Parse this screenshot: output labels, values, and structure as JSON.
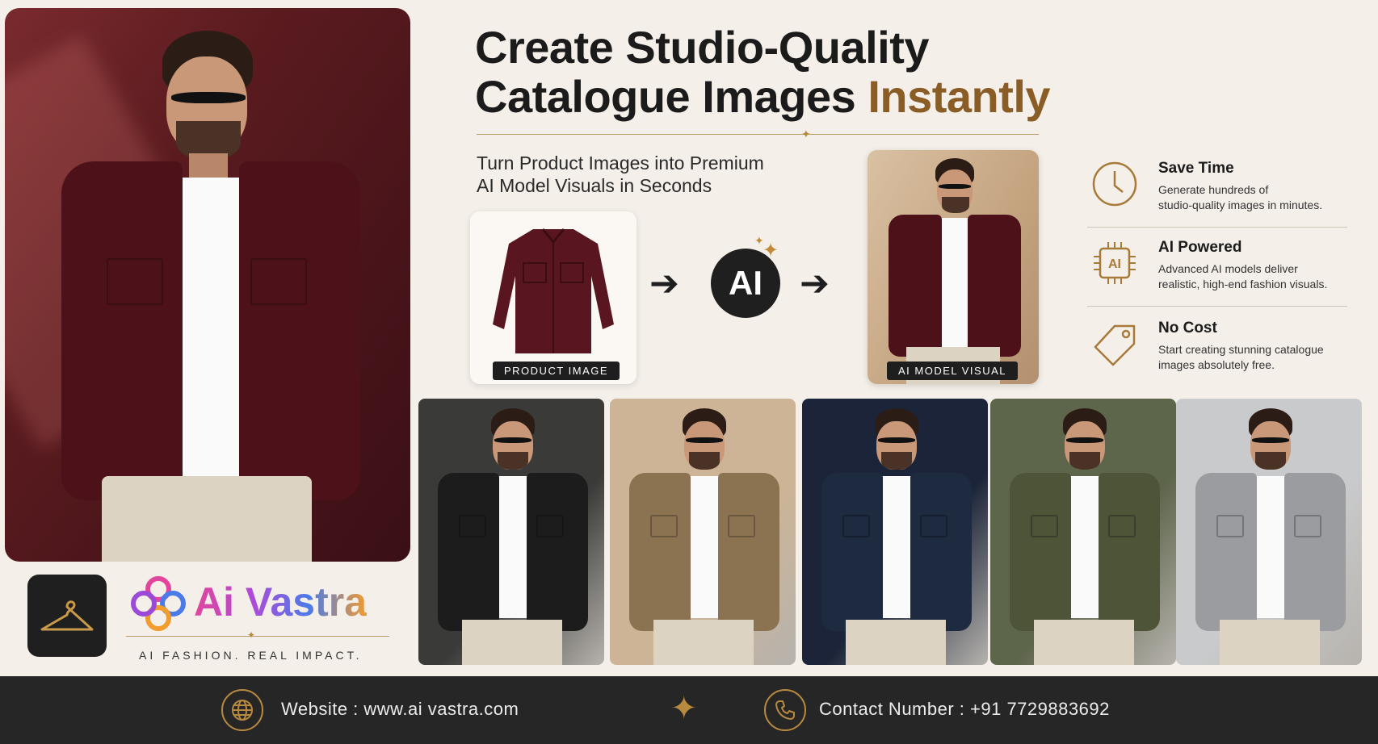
{
  "header": {
    "title_line1": "Create Studio-Quality",
    "title_line2_main": "Catalogue Images ",
    "title_line2_accent": "Instantly",
    "subtitle_line1": "Turn Product Images into Premium",
    "subtitle_line2": "AI Model Visuals in Seconds"
  },
  "workflow": {
    "product_label": "PRODUCT IMAGE",
    "ai_label": "AI",
    "result_label": "AI MODEL VISUAL"
  },
  "features": [
    {
      "icon": "clock-icon",
      "title": "Save Time",
      "text_line1": "Generate hundreds of",
      "text_line2": "studio-quality images in minutes."
    },
    {
      "icon": "ai-chip-icon",
      "title": "AI Powered",
      "text_line1": "Advanced AI models deliver",
      "text_line2": "realistic, high-end fashion visuals."
    },
    {
      "icon": "price-tag-icon",
      "title": "No Cost",
      "text_line1": "Start creating stunning catalogue",
      "text_line2": "images absolutely free."
    }
  ],
  "gallery": [
    {
      "jacket_color": "#1c1c1c",
      "bg": "#3a3a38"
    },
    {
      "jacket_color": "#8b7352",
      "bg": "#cdb496"
    },
    {
      "jacket_color": "#1e2a40",
      "bg": "#1b2438"
    },
    {
      "jacket_color": "#4d5438",
      "bg": "#5d654a"
    },
    {
      "jacket_color": "#9a9ca0",
      "bg": "#c9cacb"
    }
  ],
  "hero": {
    "jacket_color": "#4d1219"
  },
  "brand": {
    "name": "Ai Vastra",
    "tagline": "AI FASHION. REAL IMPACT.",
    "icon": "hanger-icon"
  },
  "footer": {
    "website": "Website : www.ai vastra.com",
    "contact": "Contact Number : +91 7729883692",
    "website_icon": "globe-icon",
    "contact_icon": "phone-icon"
  },
  "colors": {
    "accent": "#8a5d26",
    "gold": "#b88a3f",
    "footer_bg": "#262626",
    "page_bg": "#f4efe8"
  }
}
